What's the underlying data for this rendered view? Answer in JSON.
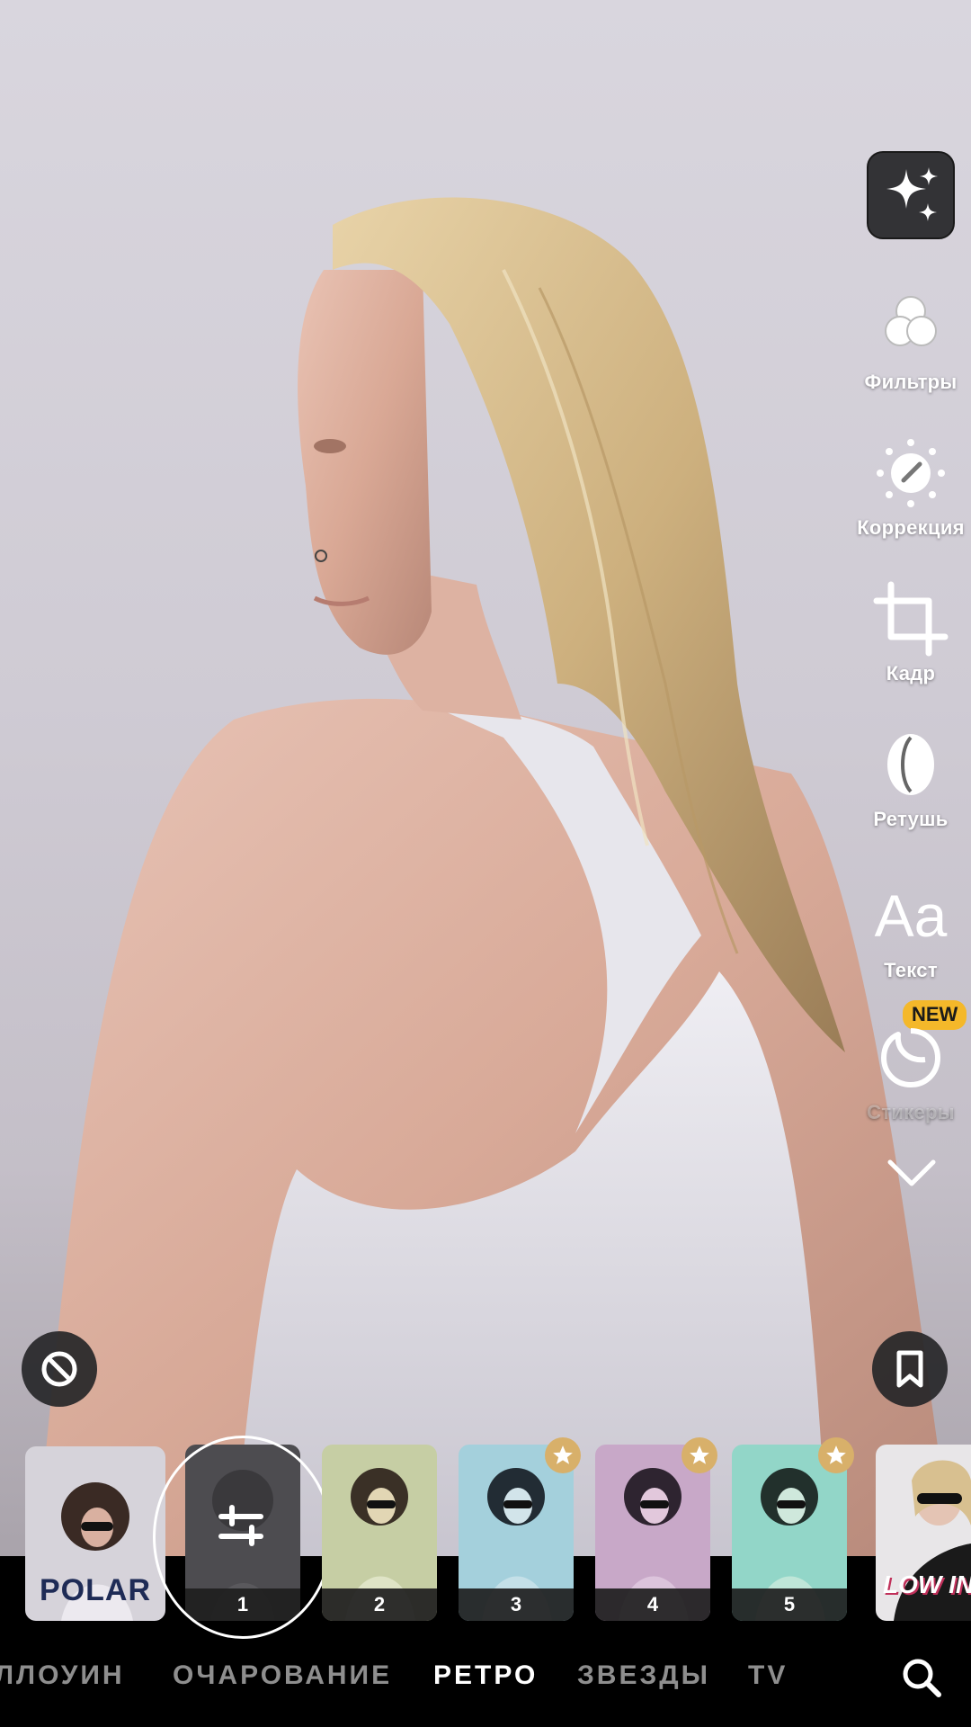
{
  "tools": {
    "magic_icon": "sparkles-icon",
    "items": [
      {
        "icon": "filters-icon",
        "label": "Фильтры"
      },
      {
        "icon": "correction-icon",
        "label": "Коррекция"
      },
      {
        "icon": "crop-icon",
        "label": "Кадр"
      },
      {
        "icon": "retouch-icon",
        "label": "Ретушь"
      },
      {
        "icon": "text-icon",
        "glyph": "Aa",
        "label": "Текст"
      },
      {
        "icon": "sticker-icon",
        "label": "Стикеры",
        "badge": "NEW"
      }
    ],
    "more_icon": "chevron-down-icon"
  },
  "floating": {
    "reset_icon": "no-filter-icon",
    "bookmark_icon": "bookmark-icon"
  },
  "filters": {
    "items": [
      {
        "label": "POLAR",
        "premium": false
      },
      {
        "label": "1",
        "premium": false,
        "selected": true
      },
      {
        "label": "2",
        "premium": false
      },
      {
        "label": "3",
        "premium": true
      },
      {
        "label": "4",
        "premium": true
      },
      {
        "label": "5",
        "premium": true
      },
      {
        "label": "LOW IN",
        "premium": false
      }
    ]
  },
  "categories": {
    "items": [
      "ЛЛОУИН",
      "ОЧАРОВАНИЕ",
      "РЕТРО",
      "ЗВЕЗДЫ",
      "TV"
    ],
    "active": "РЕТРО",
    "search_icon": "search-icon"
  },
  "colors": {
    "accent_badge": "#f4b82a",
    "premium_star": "#d8b06a",
    "panel": "#000000"
  }
}
